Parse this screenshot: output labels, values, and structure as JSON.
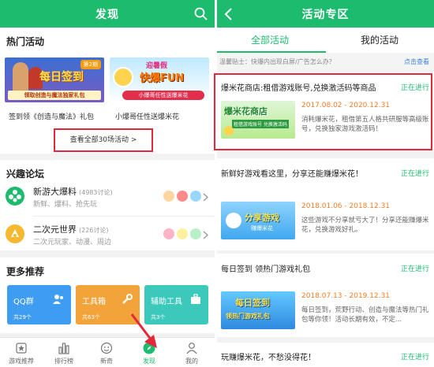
{
  "left": {
    "title": "发现",
    "hot_section": "热门活动",
    "banners": [
      {
        "caption": "签到领《创造与魔法》礼包",
        "badge": "第2期",
        "big_text": "每日签到",
        "sub_text": "领取创造与魔法独家礼包"
      },
      {
        "caption": "小爆哥任性送爆米花",
        "top_text": "迎暑假",
        "big_text": "快爆FUN",
        "sub_text": "小爆哥任性送爆米花"
      }
    ],
    "view_all": "查看全部30场活动 >",
    "forum_section": "兴趣论坛",
    "forums": [
      {
        "name": "新游大爆料",
        "count": "(4983讨论)",
        "desc": "新鲜、爆料、抢先玩"
      },
      {
        "name": "二次元世界",
        "count": "(226讨论)",
        "desc": "二次元玩家、动漫、周边"
      }
    ],
    "more_section": "更多推荐",
    "tiles": [
      {
        "name": "QQ群",
        "count": "共29个",
        "color": "#3e9df0"
      },
      {
        "name": "工具箱",
        "count": "共63个",
        "color": "#f2a33a"
      },
      {
        "name": "辅助工具",
        "count": "共3个",
        "color": "#3cc9bb"
      }
    ],
    "tabs": [
      {
        "label": "游戏推荐",
        "icon": "star-icon"
      },
      {
        "label": "排行榜",
        "icon": "bar-chart-icon"
      },
      {
        "label": "新奇",
        "icon": "face-icon"
      },
      {
        "label": "发现",
        "icon": "compass-icon"
      },
      {
        "label": "我的",
        "icon": "user-icon"
      }
    ]
  },
  "right": {
    "title": "活动专区",
    "tabs": [
      "全部活动",
      "我的活动"
    ],
    "tip": "温馨贴士：快爆内出现白屏/广告怎么办？",
    "tip_link": "点击查看",
    "activities": [
      {
        "title": "爆米花商店:租借游戏账号,兑换激活码等商品",
        "status": "正在进行",
        "date": "2017.08.02 - 2020.12.31",
        "desc": "消耗爆米花，租借第五人格共研服等高级账号，兑换独家游戏激活码！",
        "img_text": "爆米花商店",
        "img_sub": "租借游戏账号 兑换激活码"
      },
      {
        "title": "新鲜好游戏看这里，分享还能赚爆米花！",
        "status": "正在进行",
        "date": "2018.01.06 - 2018.12.31",
        "desc": "这些游戏不分享就亏大了！分享还能赚爆米花，兑换游戏好礼。",
        "img_text": "分享游戏",
        "img_sub": "赚爆米花"
      },
      {
        "title": "每日签到 领热门游戏礼包",
        "status": "正在进行",
        "date": "2018.07.13 - 2019.12.31",
        "desc": "每日签到，荒野行动、创造与魔法等热门礼包等你领！活动长期有效，不定...",
        "img_text": "每日签到",
        "img_sub": "领热门游戏礼包"
      },
      {
        "title": "玩赚爆米花，不愁没得花！",
        "status": "正在进行"
      }
    ]
  }
}
